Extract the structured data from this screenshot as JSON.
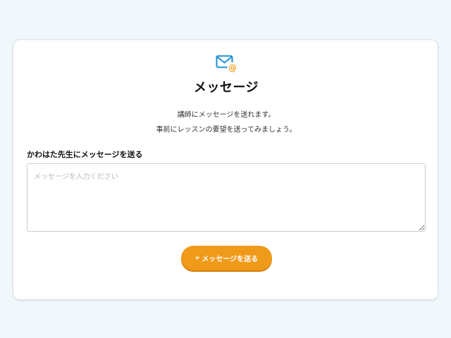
{
  "header": {
    "icon": "mail-at-icon",
    "title": "メッセージ"
  },
  "description": {
    "line1": "講師にメッセージを送れます。",
    "line2": "事前にレッスンの要望を送ってみましょう。"
  },
  "form": {
    "label": "かわはた先生にメッセージを送る",
    "message_value": "",
    "message_placeholder": "メッセージを入力ください",
    "send_prefix": "»",
    "send_label": "メッセージを送る"
  },
  "colors": {
    "page_background": "#f1f8fc",
    "accent_orange": "#f09a1a",
    "icon_blue": "#1e8ed6",
    "icon_at_orange": "#f0a11c"
  }
}
